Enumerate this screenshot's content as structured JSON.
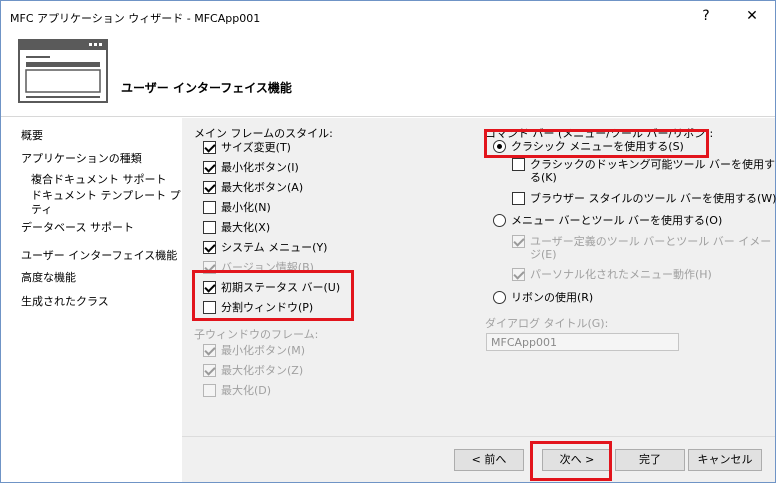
{
  "window": {
    "title": "MFC アプリケーション ウィザード - MFCApp001",
    "help_label": "?",
    "close_label": "✕"
  },
  "header": {
    "title": "ユーザー インターフェイス機能"
  },
  "nav": {
    "items": [
      "概要",
      "アプリケーションの種類",
      "複合ドキュメント サポート",
      "ドキュメント テンプレート プロパ",
      "ティ",
      "データベース サポート",
      "ユーザー インターフェイス機能",
      "高度な機能",
      "生成されたクラス"
    ]
  },
  "frame_styles": {
    "label": "メイン フレームのスタイル:",
    "options": [
      {
        "label": "サイズ変更(T)",
        "checked": true,
        "disabled": false
      },
      {
        "label": "最小化ボタン(I)",
        "checked": true,
        "disabled": false
      },
      {
        "label": "最大化ボタン(A)",
        "checked": true,
        "disabled": false
      },
      {
        "label": "最小化(N)",
        "checked": false,
        "disabled": false
      },
      {
        "label": "最大化(X)",
        "checked": false,
        "disabled": false
      },
      {
        "label": "システム メニュー(Y)",
        "checked": true,
        "disabled": false
      },
      {
        "label": "バージョン情報(B)",
        "checked": true,
        "disabled": true
      },
      {
        "label": "初期ステータス バー(U)",
        "checked": true,
        "disabled": false
      },
      {
        "label": "分割ウィンドウ(P)",
        "checked": false,
        "disabled": false
      }
    ]
  },
  "child_frame": {
    "label": "子ウィンドウのフレーム:",
    "options": [
      {
        "label": "最小化ボタン(M)",
        "checked": true,
        "disabled": true
      },
      {
        "label": "最大化ボタン(Z)",
        "checked": true,
        "disabled": true
      },
      {
        "label": "最大化(D)",
        "checked": false,
        "disabled": true
      }
    ]
  },
  "command_bar": {
    "label": "コマンド バー (メニュー/ツール バー/リボン):",
    "classic_menu": {
      "label": "クラシック メニューを使用する(S)",
      "selected": true
    },
    "docking_toolbar": {
      "line1": "クラシックのドッキング可能ツール バーを使用す",
      "line2": "る(K)",
      "checked": false
    },
    "browser_toolbar": {
      "label": "ブラウザー スタイルのツール バーを使用する(W)",
      "checked": false
    },
    "menubar_toolbar": {
      "label": "メニュー バーとツール バーを使用する(O)",
      "selected": false
    },
    "user_defined": {
      "line1": "ユーザー定義のツール バーとツール バー イメー",
      "line2": "ジ(E)",
      "checked": true,
      "disabled": true
    },
    "personalized": {
      "label": "パーソナル化されたメニュー動作(H)",
      "checked": true,
      "disabled": true
    },
    "ribbon": {
      "label": "リボンの使用(R)",
      "selected": false
    }
  },
  "dialog_title": {
    "label": "ダイアログ タイトル(G):",
    "value": "MFCApp001"
  },
  "footer": {
    "prev_label": "< 前へ",
    "next_label": "次へ >",
    "finish_label": "完了",
    "cancel_label": "キャンセル"
  },
  "colors": {
    "highlight": "#e2141c",
    "panel": "#f0f0f0",
    "border": "#6f94c6"
  }
}
